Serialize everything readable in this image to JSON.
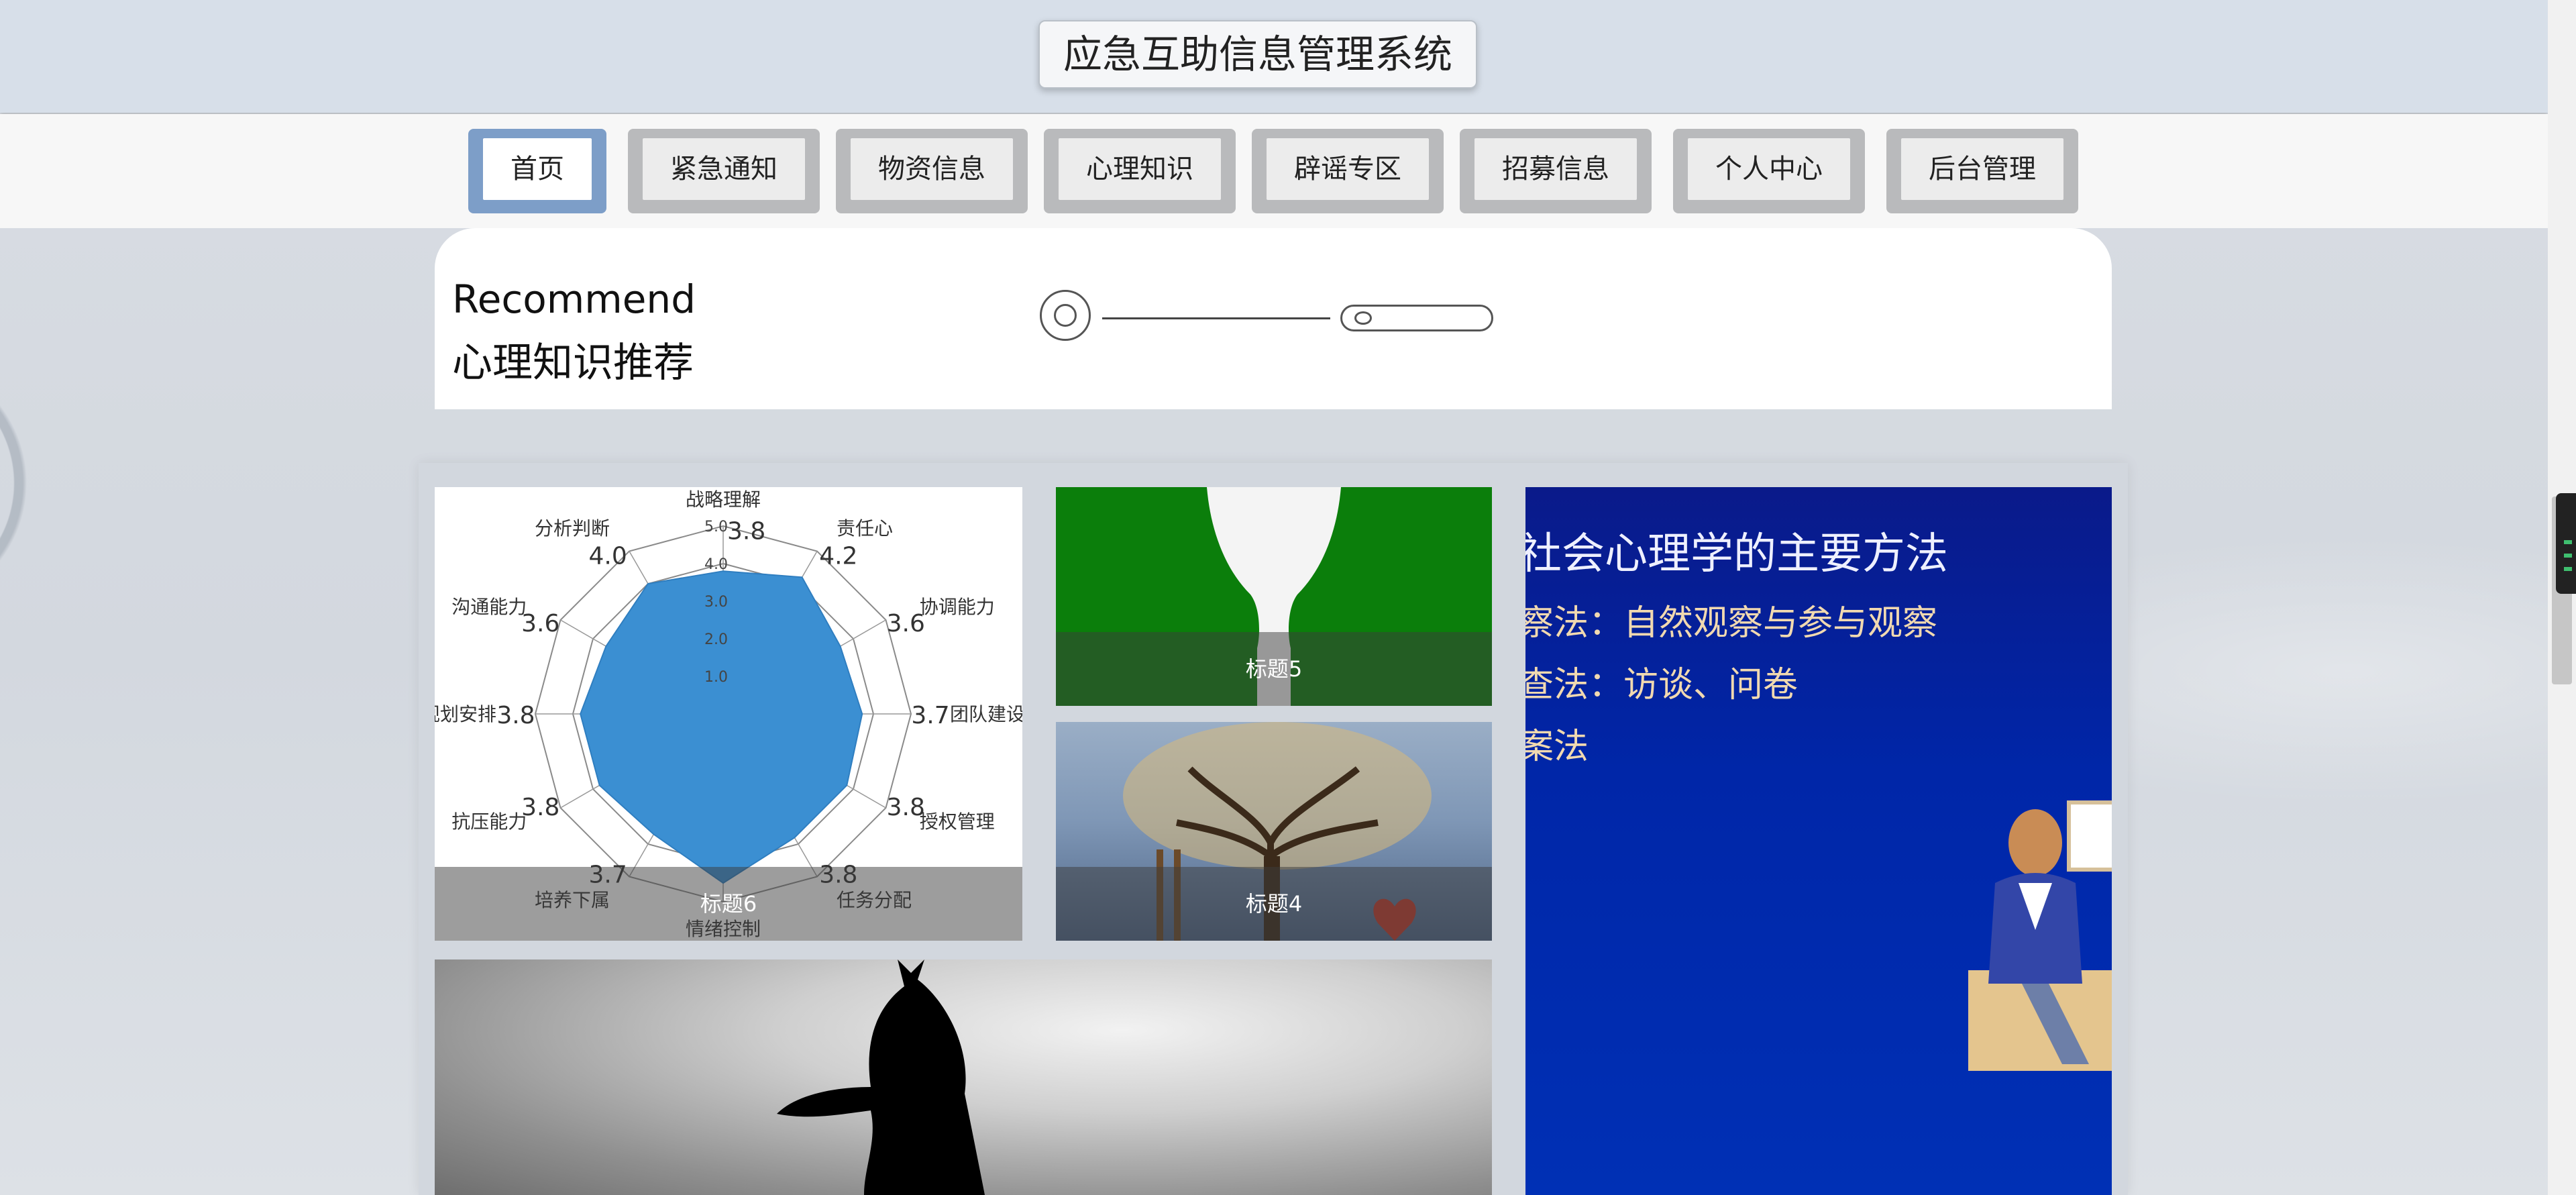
{
  "app": {
    "title": "应急互助信息管理系统"
  },
  "nav": {
    "items": [
      {
        "label": "首页",
        "active": true
      },
      {
        "label": "紧急通知",
        "active": false
      },
      {
        "label": "物资信息",
        "active": false
      },
      {
        "label": "心理知识",
        "active": false
      },
      {
        "label": "辟谣专区",
        "active": false
      },
      {
        "label": "招募信息",
        "active": false
      },
      {
        "label": "个人中心",
        "active": false
      },
      {
        "label": "后台管理",
        "active": false
      }
    ]
  },
  "recommend": {
    "title_en": "Recommend",
    "title_cn": "心理知识推荐"
  },
  "gallery": {
    "items": [
      {
        "caption": "标题6",
        "image": "radar-chart-image"
      },
      {
        "caption": "标题5",
        "image": "green-silhouette-image"
      },
      {
        "caption": "标题4",
        "image": "tree-of-hearts-image"
      },
      {
        "caption": "",
        "image": "social-psychology-slide-image"
      },
      {
        "caption": "",
        "image": "cat-silhouette-image"
      }
    ],
    "radar": {
      "axes": [
        "战略理解",
        "责任心",
        "协调能力",
        "团队建设",
        "授权管理",
        "任务分配",
        "情绪控制",
        "培养下属",
        "抗压能力",
        "规划安排",
        "沟通能力",
        "分析判断"
      ],
      "values": [
        "3.8",
        "4.2",
        "3.6",
        "3.7",
        "3.8",
        "3.8",
        "",
        "3.7",
        "3.8",
        "3.8",
        "3.6",
        "4.0"
      ],
      "scale": [
        "1.0",
        "2.0",
        "3.0",
        "4.0",
        "5.0"
      ]
    },
    "slide": {
      "title": "社会心理学的主要方法",
      "lines": [
        "察法：自然观察与参与观察",
        "查法：访谈、问卷",
        "案法"
      ]
    }
  },
  "colors": {
    "header_bg": "#d7dfe9",
    "nav_active": "#7d9ec8",
    "nav_inactive": "#b9babc",
    "radar_fill": "#3b8fd2",
    "slide_bg": "#0026a8"
  }
}
